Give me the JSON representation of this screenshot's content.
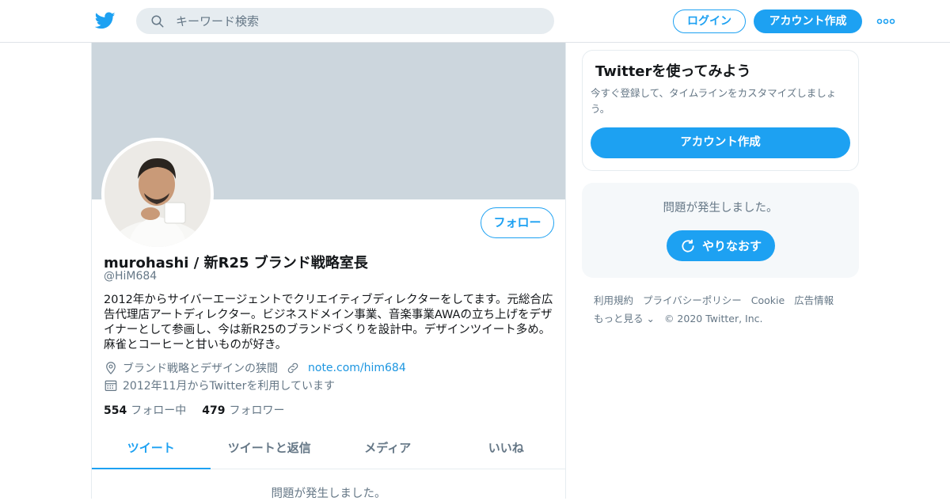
{
  "header": {
    "search_placeholder": "キーワード検索",
    "login_label": "ログイン",
    "signup_label": "アカウント作成"
  },
  "profile": {
    "name": "murohashi / 新R25 ブランド戦略室長",
    "handle": "@HiM684",
    "bio": "2012年からサイバーエージェントでクリエイティブディレクターをしてます。元総合広告代理店アートディレクター。ビジネスドメイン事業、音楽事業AWAの立ち上げをデザイナーとして参画し、今は新R25のブランドづくりを設計中。デザインツイート多め。麻雀とコーヒーと甘いものが好き。",
    "location": "ブランド戦略とデザインの狭間",
    "url": "note.com/him684",
    "joined": "2012年11月からTwitterを利用しています",
    "following_count": "554",
    "following_label": "フォロー中",
    "followers_count": "479",
    "followers_label": "フォロワー",
    "follow_button": "フォロー"
  },
  "tabs": [
    {
      "label": "ツイート",
      "active": true
    },
    {
      "label": "ツイートと返信",
      "active": false
    },
    {
      "label": "メディア",
      "active": false
    },
    {
      "label": "いいね",
      "active": false
    }
  ],
  "main_error": "問題が発生しました。",
  "sidebar": {
    "card_title": "Twitterを使ってみよう",
    "card_subtitle": "今すぐ登録して、タイムラインをカスタマイズしましょう。",
    "card_button": "アカウント作成",
    "error_text": "問題が発生しました。",
    "retry_label": "やりなおす"
  },
  "footer": {
    "links": [
      "利用規約",
      "プライバシーポリシー",
      "Cookie",
      "広告情報",
      "もっと見る ⌄"
    ],
    "copyright": "© 2020 Twitter, Inc."
  },
  "colors": {
    "accent": "#1da1f2",
    "banner": "#ccd6dd",
    "secondary_text": "#657786"
  },
  "icons": [
    "twitter-bird-icon",
    "search-icon",
    "more-dots-icon",
    "location-pin-icon",
    "link-icon",
    "calendar-icon",
    "refresh-icon"
  ]
}
